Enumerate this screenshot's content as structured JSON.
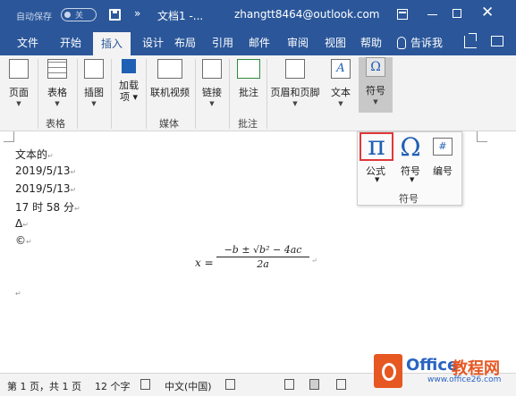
{
  "titlebar": {
    "autosave_label": "自动保存",
    "autosave_state": "关",
    "more": "»",
    "doc_name": "文档1 -...",
    "account": "zhangtt8464@outlook.com",
    "close": "✕"
  },
  "tabs": [
    {
      "label": "文件"
    },
    {
      "label": "开始"
    },
    {
      "label": "插入",
      "active": true
    },
    {
      "label": "设计"
    },
    {
      "label": "布局"
    },
    {
      "label": "引用"
    },
    {
      "label": "邮件"
    },
    {
      "label": "审阅"
    },
    {
      "label": "视图"
    },
    {
      "label": "帮助"
    },
    {
      "label": "告诉我"
    }
  ],
  "ribbon": {
    "page": "页面",
    "table": "表格",
    "illustration": "插图",
    "addin": "加载\n项 ▾",
    "online_video": "联机视频",
    "link": "链接",
    "comment": "批注",
    "header_footer": "页眉和页脚",
    "text": "文本",
    "symbol": "符号",
    "groups": {
      "table": "表格",
      "media": "媒体",
      "comment": "批注"
    }
  },
  "symbol_popup": {
    "formula": "公式",
    "symbol": "符号",
    "number": "编号",
    "group": "符号",
    "pi": "π",
    "omega": "Ω",
    "hash": "#"
  },
  "document": {
    "lines": [
      "文本的",
      "2019/5/13",
      "2019/5/13",
      "17 时 58 分",
      "Δ",
      "©"
    ],
    "paragraph_mark": "↵",
    "formula": {
      "lhs": "x =",
      "numerator": "−b ± √b² − 4ac",
      "denominator": "2a"
    }
  },
  "statusbar": {
    "page": "第 1 页，共 1 页",
    "words": "12 个字",
    "language": "中文(中国)"
  },
  "watermark": {
    "brand": "Office",
    "brand2": "教程网",
    "url": "www.office26.com"
  }
}
